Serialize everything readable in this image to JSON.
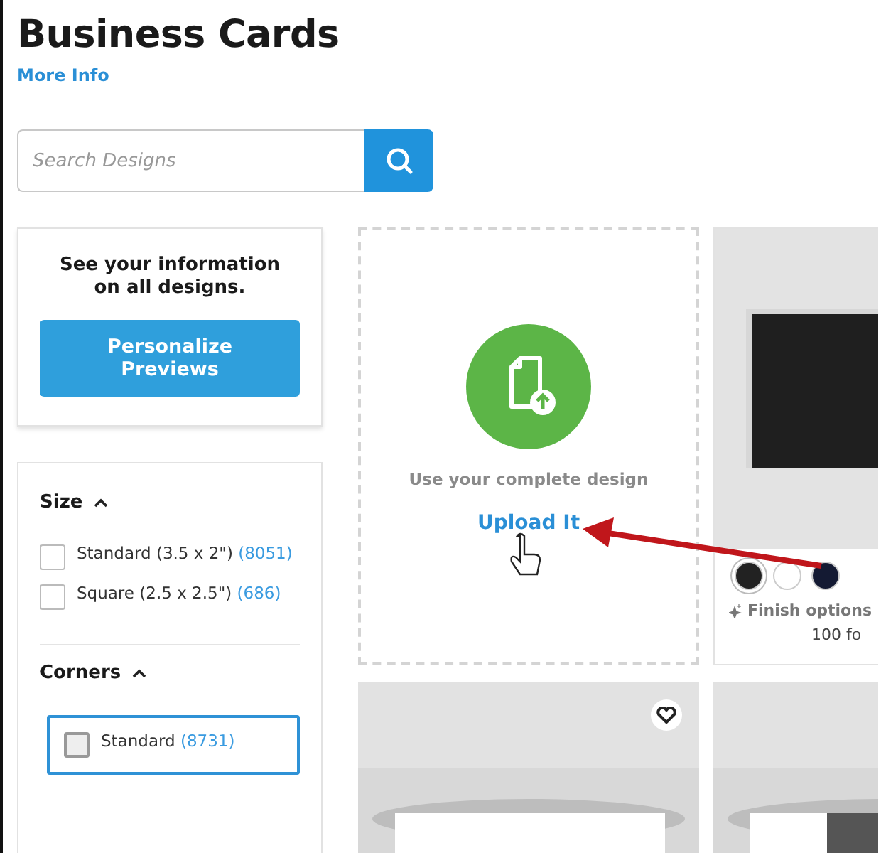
{
  "header": {
    "title": "Business Cards",
    "link": "More Info"
  },
  "search": {
    "placeholder": "Search Designs"
  },
  "personalize": {
    "text": "See your information on all designs.",
    "button": "Personalize Previews"
  },
  "filters": [
    {
      "title": "Size",
      "expanded": true,
      "options": [
        {
          "label": "Standard (3.5 x 2\")",
          "count": "(8051)",
          "checked": false,
          "focused": false
        },
        {
          "label": "Square (2.5 x 2.5\")",
          "count": "(686)",
          "checked": false,
          "focused": false
        }
      ]
    },
    {
      "title": "Corners",
      "expanded": true,
      "options": [
        {
          "label": "Standard",
          "count": "(8731)",
          "checked": false,
          "focused": true
        }
      ]
    }
  ],
  "upload_card": {
    "text": "Use your complete design",
    "link": "Upload It"
  },
  "product_card": {
    "swatches": [
      {
        "color": "#222222",
        "selected": true
      },
      {
        "color": "#ffffff",
        "selected": false
      },
      {
        "color": "#141a33",
        "selected": false
      }
    ],
    "finish": "Finish options",
    "price": "100 fo"
  }
}
